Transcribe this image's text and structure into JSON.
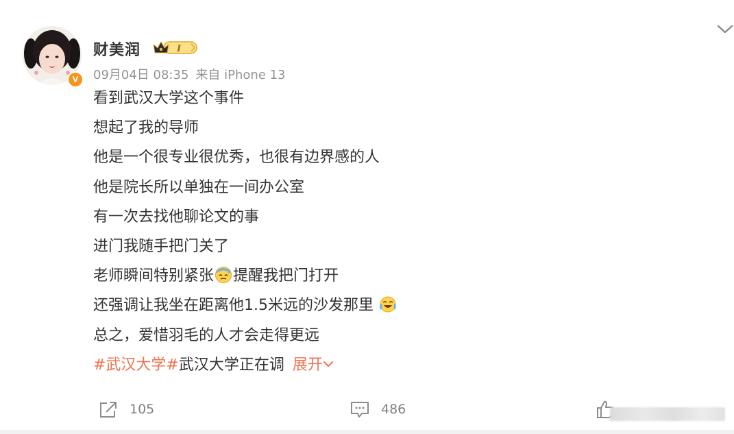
{
  "post": {
    "author": {
      "name": "财美润",
      "vip_level": "I",
      "verified_mark": "V"
    },
    "meta": {
      "date": "09月04日 08:35",
      "source": "来自 iPhone 13"
    },
    "lines": [
      "看到武汉大学这个事件",
      "想起了我的导师",
      "他是一个很专业很优秀，也很有边界感的人",
      "他是院长所以单独在一间办公室",
      "有一次去找他聊论文的事",
      "进门我随手把门关了",
      "老师瞬间特别紧张",
      "提醒我把门打开",
      "还强调让我坐在距离他1.5米远的沙发那里",
      "总之，爱惜羽毛的人才会走得更远"
    ],
    "hashtag": "#武汉大学#",
    "truncated_text": "武汉大学正在调",
    "expand_label": "展开"
  },
  "actions": {
    "repost_count": "105",
    "comment_count": "486"
  },
  "icons": {
    "options": "chevron-down-icon",
    "vip": "crown-vip-icon",
    "emoji_nervous": "sweat-emoji-icon",
    "emoji_laugh": "laugh-cry-emoji-icon",
    "repost": "repost-icon",
    "comment": "comment-icon",
    "like": "thumbs-up-icon"
  },
  "colors": {
    "link": "#eb7350",
    "meta": "#939393",
    "text": "#333333",
    "verified": "#f7941d",
    "vip_gold": "#f5c242"
  }
}
